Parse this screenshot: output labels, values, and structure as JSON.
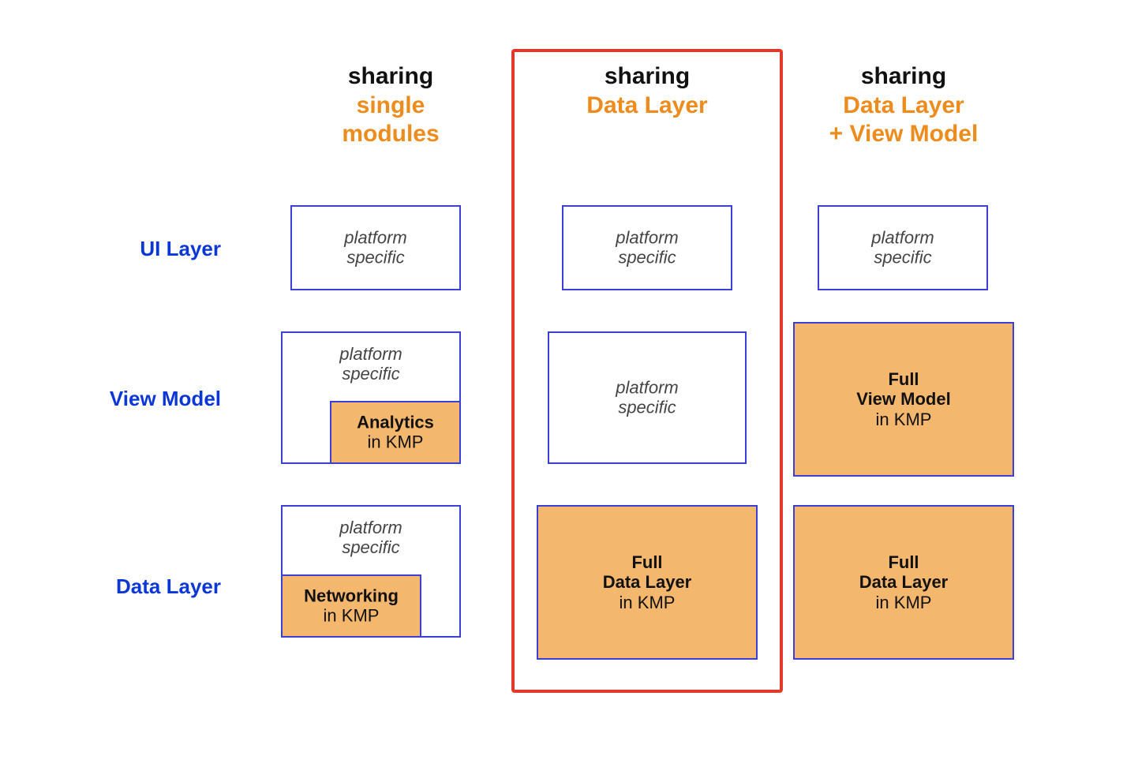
{
  "colors": {
    "blue_label": "#0b37d6",
    "blue_border": "#3b3fd6",
    "orange_text": "#ed8b1c",
    "orange_fill": "#f4b76e",
    "red_frame": "#e13a2c",
    "black": "#111111"
  },
  "row_labels": {
    "ui": "UI Layer",
    "vm": "View Model",
    "dl": "Data Layer"
  },
  "columns": {
    "c1": {
      "sharing": "sharing",
      "sub_line1": "single",
      "sub_line2": "modules"
    },
    "c2": {
      "sharing": "sharing",
      "sub_line1": "Data Layer",
      "highlighted": true
    },
    "c3": {
      "sharing": "sharing",
      "sub_line1": "Data Layer",
      "sub_line2": "+ View Model"
    }
  },
  "labels": {
    "platform": "platform",
    "specific": "specific",
    "analytics": "Analytics",
    "networking": "Networking",
    "in_kmp": "in KMP",
    "full": "Full",
    "data_layer": "Data Layer",
    "view_model": "View Model"
  }
}
